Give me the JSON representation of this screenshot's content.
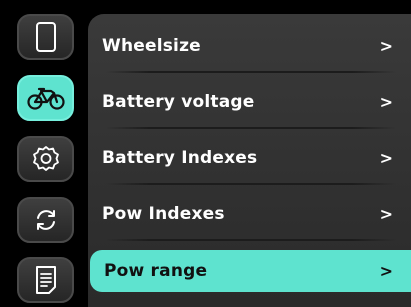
{
  "sidebar": {
    "buttons": [
      {
        "icon": "phone-device-icon",
        "active": false
      },
      {
        "icon": "bicycle-icon",
        "active": true
      },
      {
        "icon": "gear-icon",
        "active": false
      },
      {
        "icon": "refresh-icon",
        "active": false
      },
      {
        "icon": "document-icon",
        "active": false
      }
    ]
  },
  "menu": {
    "items": [
      {
        "label": "Wheelsize",
        "chevron": ">"
      },
      {
        "label": "Battery voltage",
        "chevron": ">"
      },
      {
        "label": "Battery Indexes",
        "chevron": ">"
      },
      {
        "label": "Pow Indexes",
        "chevron": ">"
      },
      {
        "label": "Pow range",
        "chevron": ">",
        "selected": true
      }
    ]
  },
  "colors": {
    "accent": "#5ee3cf",
    "panel": "#333333",
    "background": "#000000"
  }
}
